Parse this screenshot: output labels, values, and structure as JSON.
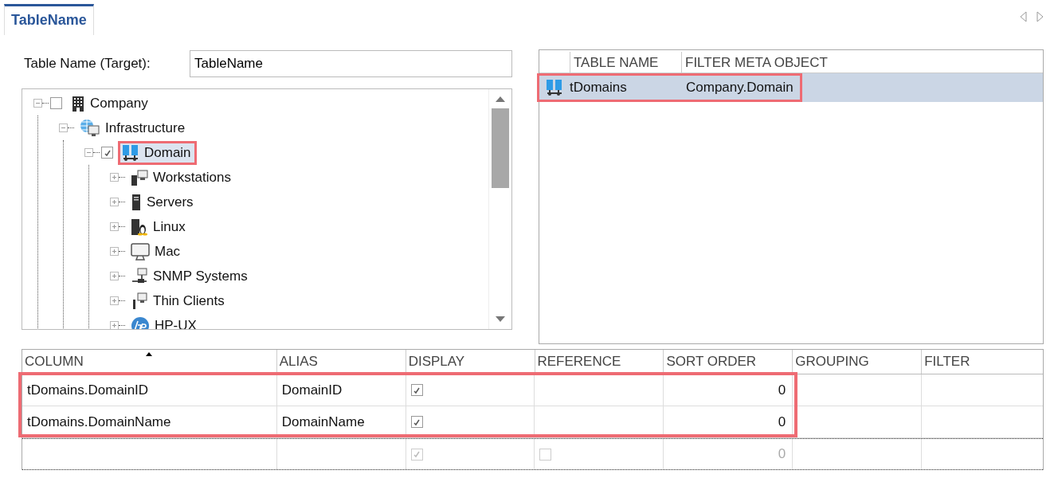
{
  "tabs": [
    {
      "label": "TableName",
      "selected": true
    }
  ],
  "target": {
    "label": "Table Name (Target):",
    "value": "TableName"
  },
  "tree": [
    {
      "label": "Company",
      "kind": "building",
      "checked": false,
      "expanded": true,
      "highlighted": false,
      "children": [
        {
          "label": "Infrastructure",
          "kind": "globe",
          "expanded": true,
          "highlighted": false,
          "children": [
            {
              "label": "Domain",
              "kind": "servers",
              "checked": true,
              "expanded": true,
              "highlighted": true,
              "children": [
                {
                  "label": "Workstations",
                  "kind": "workstation",
                  "expanded": false,
                  "highlighted": false
                },
                {
                  "label": "Servers",
                  "kind": "server",
                  "expanded": false,
                  "highlighted": false
                },
                {
                  "label": "Linux",
                  "kind": "linux",
                  "expanded": false,
                  "highlighted": false
                },
                {
                  "label": "Mac",
                  "kind": "monitor",
                  "expanded": false,
                  "highlighted": false
                },
                {
                  "label": "SNMP Systems",
                  "kind": "snmp",
                  "expanded": false,
                  "highlighted": false
                },
                {
                  "label": "Thin Clients",
                  "kind": "thin",
                  "expanded": false,
                  "highlighted": false
                },
                {
                  "label": "HP-UX",
                  "kind": "hp",
                  "expanded": false,
                  "highlighted": false
                }
              ]
            }
          ]
        }
      ]
    }
  ],
  "tables": {
    "columns": [
      "TABLE NAME",
      "FILTER META OBJECT"
    ],
    "rows": [
      {
        "table_name": "tDomains",
        "filter_meta_object": "Company.Domain",
        "selected": true,
        "highlighted": true
      }
    ]
  },
  "grid": {
    "columns": [
      {
        "label": "COLUMN",
        "sorted": true
      },
      {
        "label": "ALIAS",
        "sorted": false
      },
      {
        "label": "DISPLAY",
        "sorted": false
      },
      {
        "label": "REFERENCE",
        "sorted": false
      },
      {
        "label": "SORT ORDER",
        "sorted": false
      },
      {
        "label": "GROUPING",
        "sorted": false
      },
      {
        "label": "FILTER",
        "sorted": false
      }
    ],
    "rows": [
      {
        "kind": "data",
        "column": "tDomains.DomainID",
        "alias": "DomainID",
        "display": true,
        "sort_order": "0",
        "highlighted": true
      },
      {
        "kind": "data",
        "column": "tDomains.DomainName",
        "alias": "DomainName",
        "display": true,
        "sort_order": "0",
        "highlighted": true
      },
      {
        "kind": "new",
        "display": true,
        "reference": false,
        "sort_order": "0",
        "highlighted": false
      }
    ]
  }
}
